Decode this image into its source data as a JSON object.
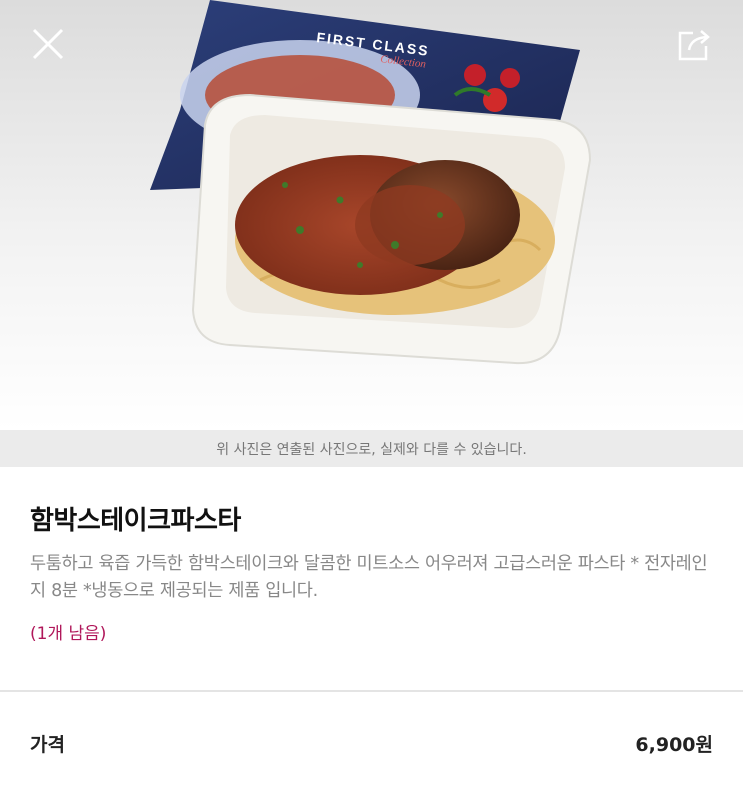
{
  "header": {
    "close_icon": "close-icon",
    "share_icon": "share-icon"
  },
  "hero": {
    "package_brand_line1": "FIRST CLASS",
    "package_brand_line2": "Collection"
  },
  "notice": {
    "text": "위 사진은 연출된 사진으로, 실제와 다를 수 있습니다."
  },
  "product": {
    "title": "함박스테이크파스타",
    "description": "두툼하고 육즙 가득한 함박스테이크와 달콤한 미트소스 어우러져 고급스러운 파스타  * 전자레인지 8분 *냉동으로 제공되는 제품 입니다.",
    "stock": "(1개 남음)"
  },
  "price": {
    "label": "가격",
    "value": "6,900원"
  },
  "colors": {
    "stock_accent": "#b0175a",
    "notice_bg": "#ebebeb"
  }
}
